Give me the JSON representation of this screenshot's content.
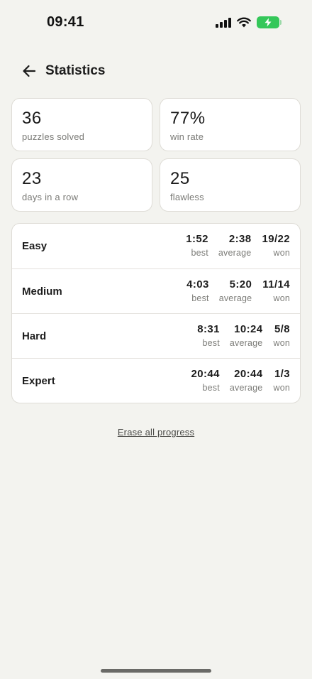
{
  "status_bar": {
    "time": "09:41",
    "icons": [
      "signal-icon",
      "wifi-icon",
      "battery-charging-icon"
    ],
    "battery_color": "#34c759"
  },
  "header": {
    "back_icon": "arrow-left-icon",
    "title": "Statistics"
  },
  "summary": [
    {
      "value": "36",
      "label": "puzzles solved"
    },
    {
      "value": "77%",
      "label": "win rate"
    },
    {
      "value": "23",
      "label": "days in a row"
    },
    {
      "value": "25",
      "label": "flawless"
    }
  ],
  "difficulty": {
    "captions": {
      "best": "best",
      "average": "average",
      "won": "won"
    },
    "rows": [
      {
        "name": "Easy",
        "best": "1:52",
        "average": "2:38",
        "won": "19/22"
      },
      {
        "name": "Medium",
        "best": "4:03",
        "average": "5:20",
        "won": "11/14"
      },
      {
        "name": "Hard",
        "best": "8:31",
        "average": "10:24",
        "won": "5/8"
      },
      {
        "name": "Expert",
        "best": "20:44",
        "average": "20:44",
        "won": "1/3"
      }
    ]
  },
  "erase_label": "Erase all progress"
}
